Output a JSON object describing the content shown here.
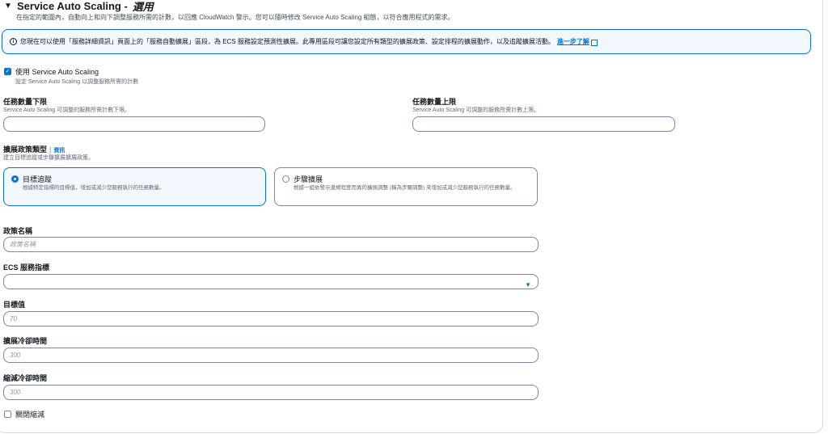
{
  "header": {
    "caret": "▼",
    "title": "Service Auto Scaling - ",
    "title_suffix": "選用",
    "description": "在指定的範圍內，自動向上和向下調整服務所需的計數，以回應 CloudWatch 警示。您可以隨時修改 Service Auto Scaling 組態，以符合應用程式的需求。"
  },
  "info_banner": {
    "icon": "i",
    "text": "您現在可以使用「服務詳細資訊」頁面上的「服務自動擴展」區段，為 ECS 服務設定預測性擴展。此專用區段可讓您設定所有類型的擴展政策、設定排程的擴展動作，以及追蹤擴展活動。",
    "link": "進一步了解"
  },
  "use_autoscaling": {
    "checked": true,
    "label": "使用 Service Auto Scaling",
    "description": "設定 Service Auto Scaling 以調整服務所需的計數"
  },
  "min_tasks": {
    "label": "任務數量下限",
    "description": "Service Auto Scaling 可調整的服務所需計數下限。",
    "value": ""
  },
  "max_tasks": {
    "label": "任務數量上限",
    "description": "Service Auto Scaling 可調整的服務所需計數上限。",
    "value": ""
  },
  "policy_type": {
    "label": "擴展政策類型",
    "info_link": "資訊",
    "description": "建立目標追蹤或步驟擴展擴展政策。",
    "options": [
      {
        "label": "目標追蹤",
        "description": "根據特定指標的目標值，增加或減少您服務執行的任務數量。",
        "selected": true
      },
      {
        "label": "步驟擴展",
        "description": "根據一組依警示違規程度而異的擴展調整 (稱為步驟調整) 來增加或減少您服務執行的任務數量。",
        "selected": false
      }
    ]
  },
  "policy_name": {
    "label": "政策名稱",
    "placeholder": "政策名稱"
  },
  "ecs_metric": {
    "label": "ECS 服務指標",
    "value": "",
    "arrow": "▼"
  },
  "target_value": {
    "label": "目標值",
    "placeholder": "70"
  },
  "scale_out_cooldown": {
    "label": "擴展冷卻時間",
    "placeholder": "300"
  },
  "scale_in_cooldown": {
    "label": "縮減冷卻時間",
    "placeholder": "300"
  },
  "disable_scale_in": {
    "checked": false,
    "label": "關閉縮減"
  }
}
